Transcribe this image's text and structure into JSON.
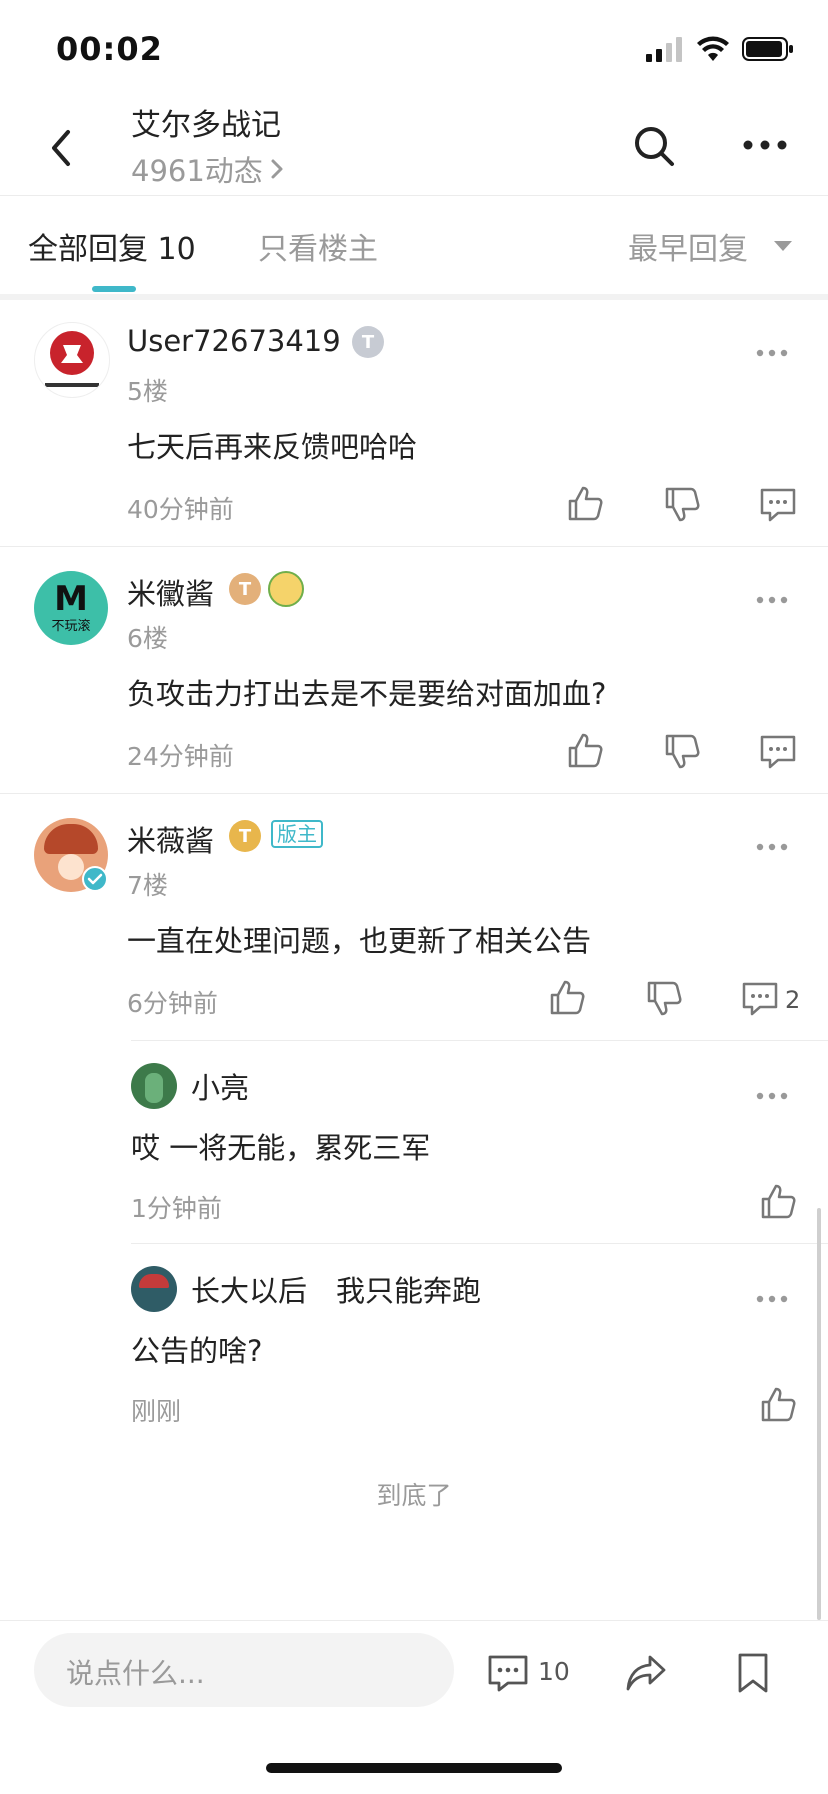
{
  "status_bar": {
    "time": "00:02"
  },
  "header": {
    "title": "艾尔多战记",
    "subtitle": "4961动态"
  },
  "tabs": {
    "all_replies_label": "全部回复",
    "all_replies_count": "10",
    "op_only_label": "只看楼主",
    "sort_label": "最早回复"
  },
  "comments": [
    {
      "username": "User72673419",
      "badge": "T3",
      "floor": "5楼",
      "text": "七天后再来反馈吧哈哈",
      "time": "40分钟前",
      "avatar_text": "KATANA GAME"
    },
    {
      "username": "米黴酱",
      "badge": "T6",
      "floor": "6楼",
      "text": "负攻击力打出去是不是要给对面加血?",
      "time": "24分钟前",
      "avatar_text": "不玩滚"
    },
    {
      "username": "米薇酱",
      "badge": "T1",
      "mod_label": "版主",
      "floor": "7楼",
      "text": "一直在处理问题，也更新了相关公告",
      "time": "6分钟前",
      "reply_count": "2"
    }
  ],
  "replies": [
    {
      "username": "小亮",
      "text": "哎 一将无能，累死三军",
      "time": "1分钟前"
    },
    {
      "username": "长大以后　我只能奔跑",
      "text": "公告的啥?",
      "time": "刚刚"
    }
  ],
  "end_text": "到底了",
  "bottom_bar": {
    "placeholder": "说点什么...",
    "comment_count": "10"
  },
  "colors": {
    "accent": "#3fb8c9",
    "gold": "#e8b64c",
    "silver": "#b9bdc7",
    "bronze": "#e3b07a"
  },
  "icons": [
    "back-icon",
    "search-icon",
    "more-icon",
    "like-icon",
    "dislike-icon",
    "comment-icon",
    "share-icon",
    "bookmark-icon",
    "verified-icon"
  ]
}
